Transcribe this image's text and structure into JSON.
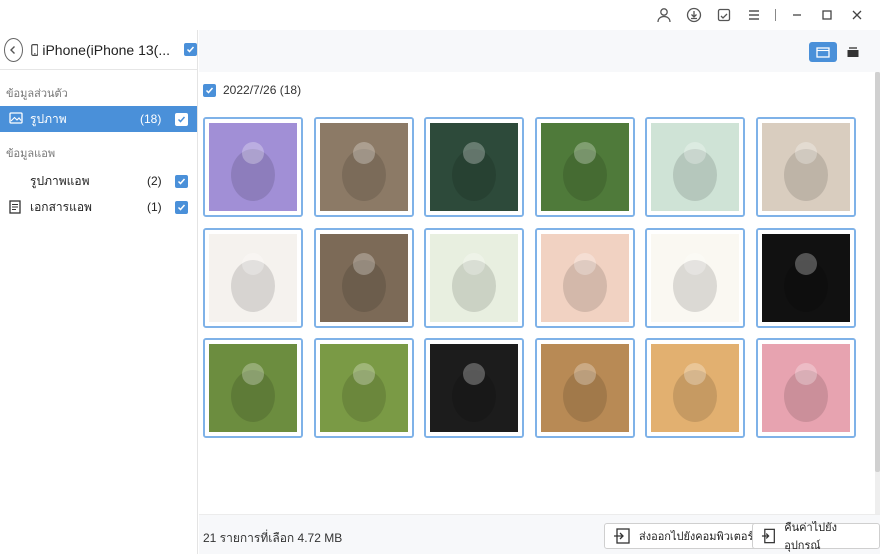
{
  "window": {
    "controls": [
      "user-icon",
      "download-icon",
      "feedback-icon",
      "menu-icon",
      "minimize-icon",
      "maximize-icon",
      "close-icon"
    ]
  },
  "device": {
    "name": "iPhone(iPhone 13(...",
    "checked": true
  },
  "sidebar": {
    "sections": [
      {
        "title": "ข้อมูลส่วนตัว",
        "items": [
          {
            "label": "รูปภาพ",
            "count": "(18)",
            "icon": "photo-icon",
            "selected": true,
            "checked": true
          }
        ]
      },
      {
        "title": "ข้อมูลแอพ",
        "items": [
          {
            "label": "รูปภาพแอพ",
            "count": "(2)",
            "icon": "",
            "selected": false,
            "checked": true
          },
          {
            "label": "เอกสารแอพ",
            "count": "(1)",
            "icon": "document-icon",
            "selected": false,
            "checked": true
          }
        ]
      }
    ]
  },
  "view_modes": [
    "grid-view-icon",
    "list-view-icon"
  ],
  "group": {
    "date_label": "2022/7/26 (18)",
    "checked": true
  },
  "photos": [
    {
      "subject": "hand-holding-phone",
      "color": "#a18fd6"
    },
    {
      "subject": "people-with-dogs-street",
      "color": "#8c7a66"
    },
    {
      "subject": "winter-tree-snowman",
      "color": "#2d4a3a"
    },
    {
      "subject": "girl-in-garden",
      "color": "#4f7a3a"
    },
    {
      "subject": "cartoon-puppy",
      "color": "#cfe3d6"
    },
    {
      "subject": "fluffy-cat-lying",
      "color": "#d9cdbf"
    },
    {
      "subject": "yorkshire-terrier",
      "color": "#f5f2ee"
    },
    {
      "subject": "castle-on-phone",
      "color": "#7c6a57"
    },
    {
      "subject": "cactus-pattern",
      "color": "#e8efe0"
    },
    {
      "subject": "signpost-landscape",
      "color": "#f1d2c2"
    },
    {
      "subject": "anime-girl-glasses",
      "color": "#faf8f2"
    },
    {
      "subject": "cartoon-cat-black-bg",
      "color": "#111111"
    },
    {
      "subject": "kitten-in-grass",
      "color": "#6c8d3f"
    },
    {
      "subject": "corgis-on-lawn",
      "color": "#7a9a45"
    },
    {
      "subject": "white-kitten",
      "color": "#1c1c1c"
    },
    {
      "subject": "cat-close-up",
      "color": "#b88a55"
    },
    {
      "subject": "tabby-cat-sitting",
      "color": "#e2b070"
    },
    {
      "subject": "dogs-pink-bg",
      "color": "#e7a3b0"
    }
  ],
  "footer": {
    "status": "21 รายการที่เลือก 4.72 MB",
    "export_label": "ส่งออกไปยังคอมพิวเตอร์",
    "restore_label": "คืนค่าไปยังอุปกรณ์"
  },
  "colors": {
    "accent": "#4a90d9",
    "thumb_border": "#7fb2e8"
  }
}
